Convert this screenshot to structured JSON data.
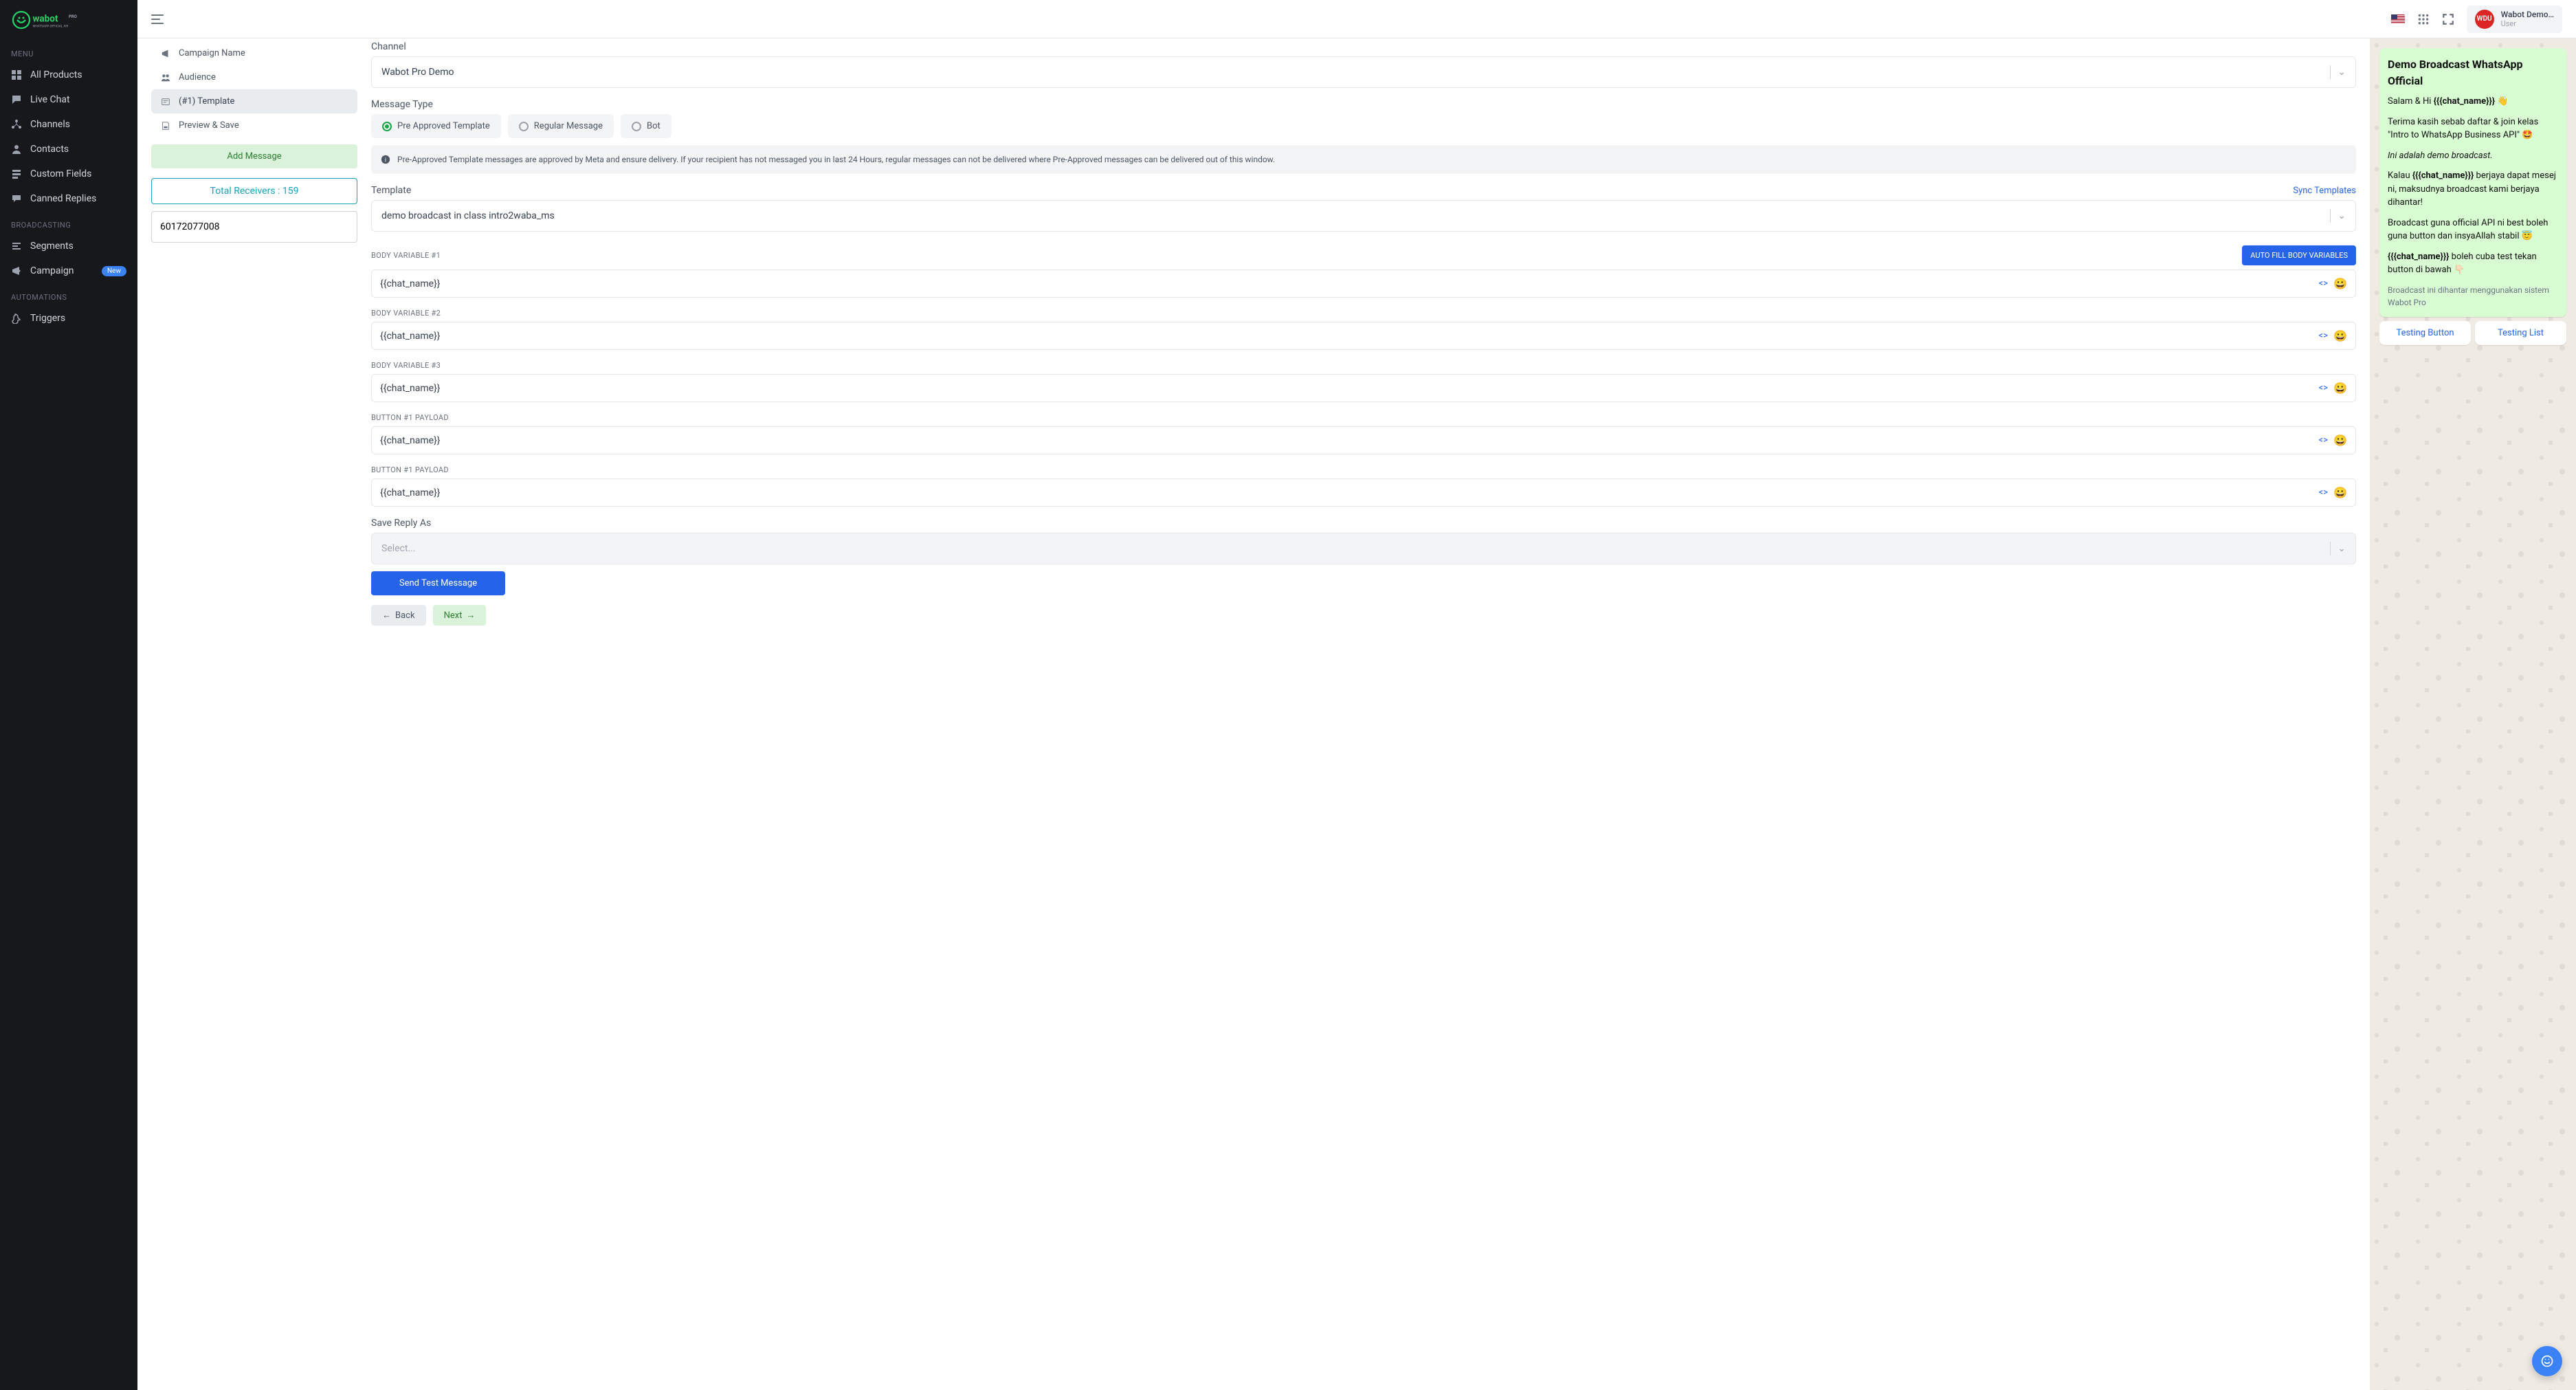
{
  "brand": {
    "name": "wabot",
    "suffix": "PRO",
    "tagline": "WHATSAPP OFFICIAL API"
  },
  "sidebar": {
    "heading1": "MENU",
    "items1": [
      {
        "label": "All Products"
      },
      {
        "label": "Live Chat"
      },
      {
        "label": "Channels"
      },
      {
        "label": "Contacts"
      },
      {
        "label": "Custom Fields"
      },
      {
        "label": "Canned Replies"
      }
    ],
    "heading2": "BROADCASTING",
    "items2": [
      {
        "label": "Segments"
      },
      {
        "label": "Campaign",
        "badge": "New"
      }
    ],
    "heading3": "AUTOMATIONS",
    "items3": [
      {
        "label": "Triggers"
      }
    ]
  },
  "topbar": {
    "user_name": "Wabot Demo…",
    "user_role": "User",
    "avatar_initials": "WDU"
  },
  "steps": {
    "s1": "Campaign Name",
    "s2": "Audience",
    "s3": "(#1) Template",
    "s4": "Preview & Save",
    "add_message": "Add Message",
    "total_receivers": "Total Receivers : 159",
    "phone_value": "60172077008"
  },
  "form": {
    "channel_label": "Channel",
    "channel_value": "Wabot Pro Demo",
    "msg_type_label": "Message Type",
    "opt_pre": "Pre Approved Template",
    "opt_reg": "Regular Message",
    "opt_bot": "Bot",
    "info_text": "Pre-Approved Template messages are approved by Meta and ensure delivery. If your recipient has not messaged you in last 24 Hours, regular messages can not be delivered where Pre-Approved messages can be delivered out of this window.",
    "template_label": "Template",
    "sync_label": "Sync Templates",
    "template_value": "demo broadcast in class intro2waba_ms",
    "bv1_label": "BODY VARIABLE #1",
    "autofill_label": "AUTO FILL BODY VARIABLES",
    "bv2_label": "BODY VARIABLE #2",
    "bv3_label": "BODY VARIABLE #3",
    "btn1_label": "BUTTON #1 PAYLOAD",
    "btn2_label": "BUTTON #1 PAYLOAD",
    "var_value": "{{chat_name}}",
    "save_reply_label": "Save Reply As",
    "select_placeholder": "Select...",
    "send_test": "Send Test Message",
    "back": "Back",
    "next": "Next"
  },
  "preview": {
    "title": "Demo Broadcast WhatsApp Official",
    "p1a": "Salam & Hi ",
    "p1b": "{{{chat_name}}}",
    "p1c": " 👋",
    "p2": "Terima kasih sebab daftar & join kelas \"Intro to WhatsApp Business API\" 🤩",
    "p3": "Ini adalah demo broadcast.",
    "p4a": "Kalau ",
    "p4b": "{{{chat_name}}}",
    "p4c": " berjaya dapat mesej ni, maksudnya broadcast kami berjaya dihantar!",
    "p5": "Broadcast guna official API ni best boleh guna button dan insyaAllah stabil 😇",
    "p6a": "{{{chat_name}}}",
    "p6b": " boleh cuba test tekan button di bawah 👇🏻",
    "footer": "Broadcast ini dihantar menggunakan sistem Wabot Pro",
    "btn1": "Testing Button",
    "btn2": "Testing List"
  }
}
